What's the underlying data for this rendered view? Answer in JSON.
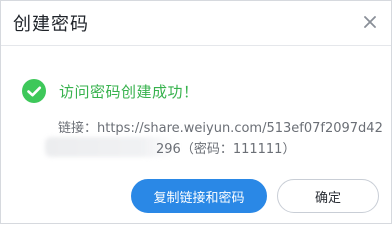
{
  "dialog": {
    "title": "创建密码",
    "close_label": "×",
    "success_message": "访问密码创建成功！",
    "link_line1": "链接：https://share.weiyun.com/513ef07f2097d42",
    "link_line2_visible": "296（密码：111111）",
    "primary_button": "复制链接和密码",
    "secondary_button": "确定",
    "colors": {
      "success": "#37b24d",
      "primary": "#2a88e6"
    },
    "icons": {
      "success": "check-circle-icon",
      "close": "close-icon"
    }
  }
}
